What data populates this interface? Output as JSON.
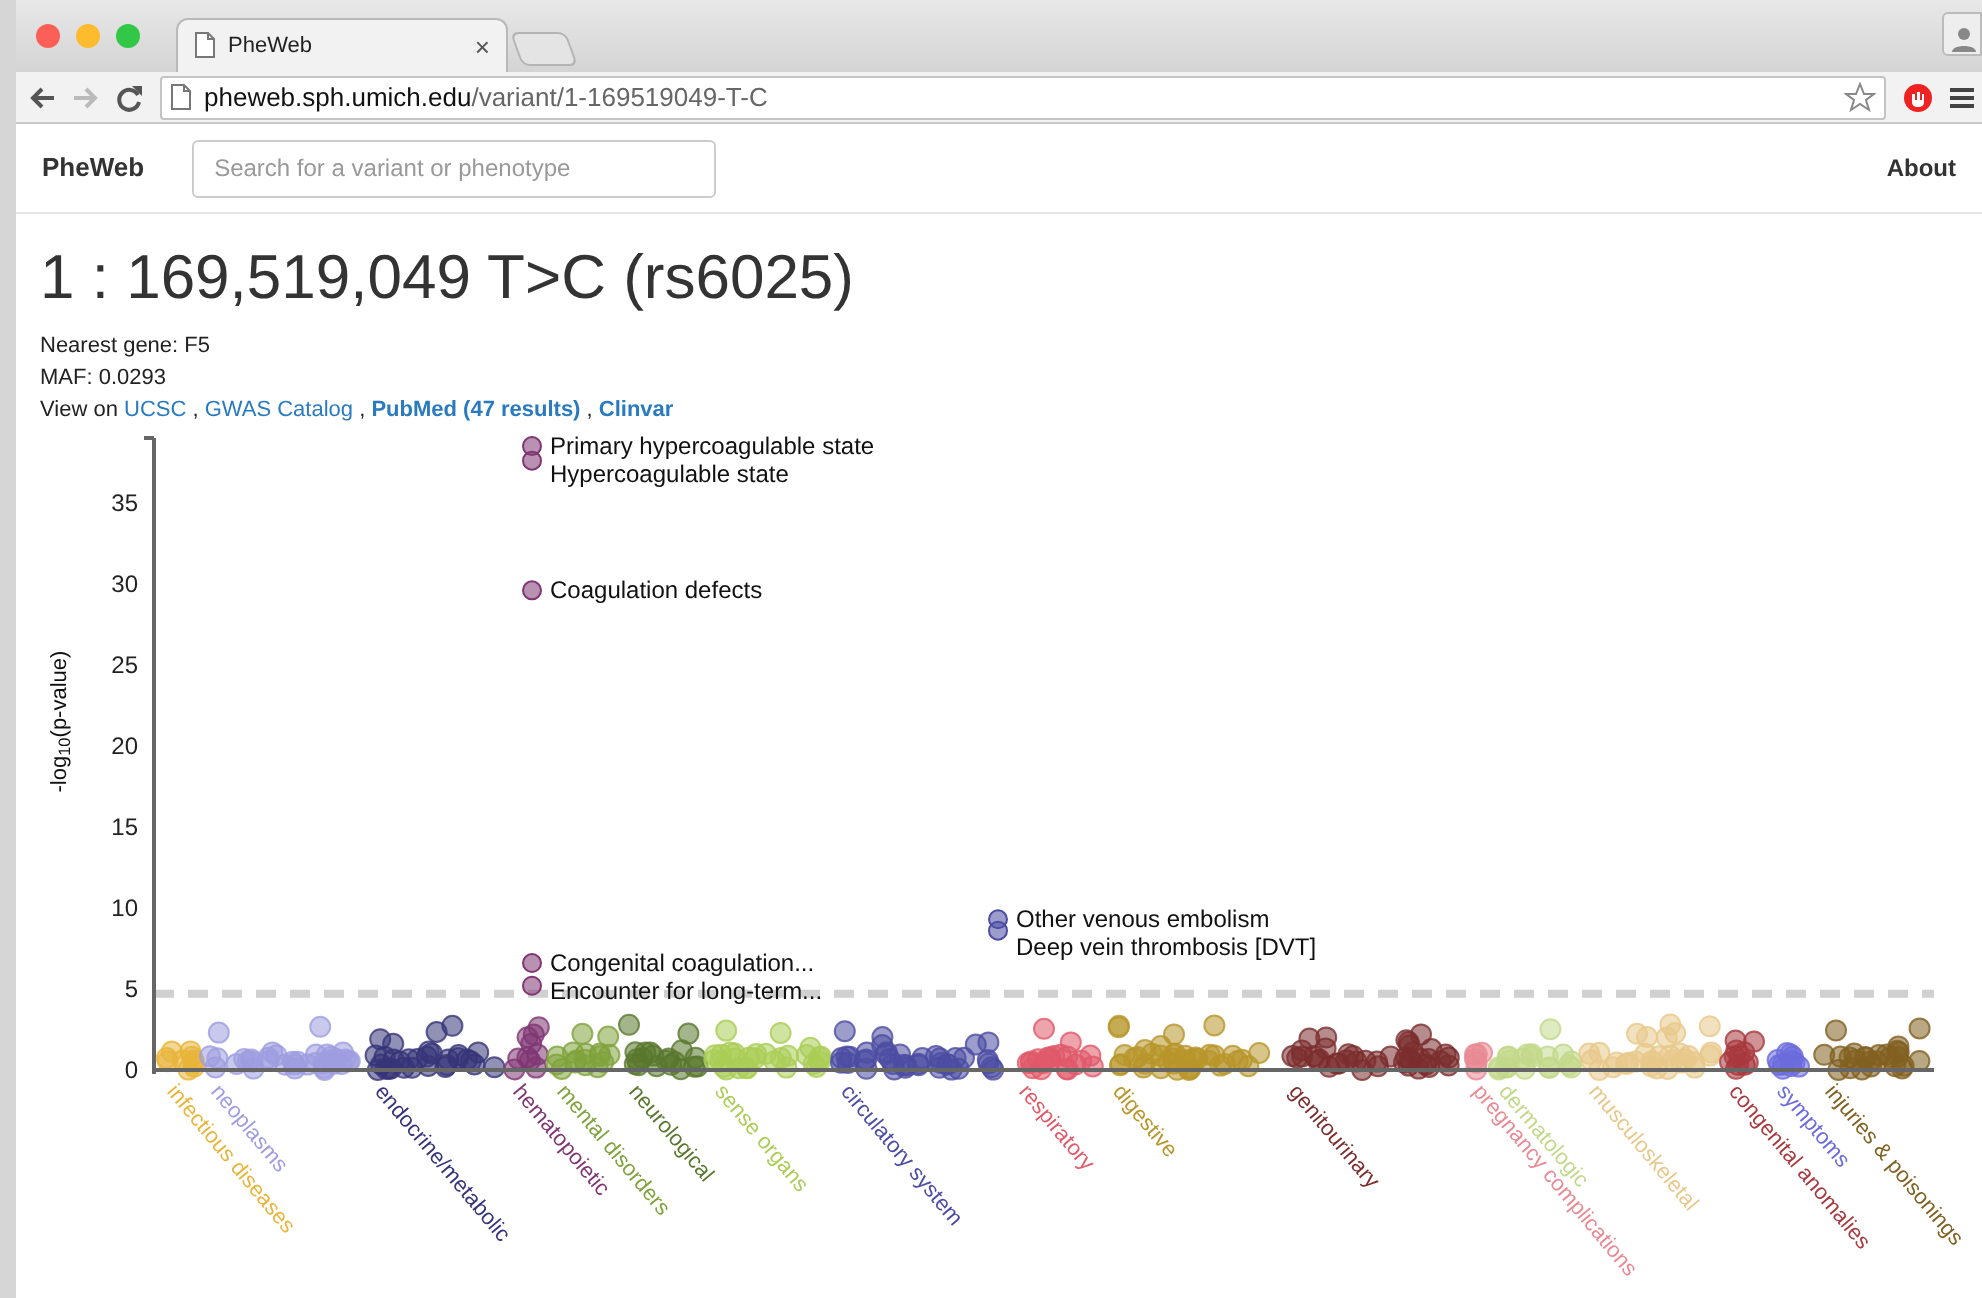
{
  "browser": {
    "tab": {
      "title": "PheWeb",
      "close": "×"
    },
    "address": {
      "host": "pheweb.sph.umich.edu",
      "path": "/variant/1-169519049-T-C"
    }
  },
  "navbar": {
    "brand": "PheWeb",
    "search": {
      "placeholder": "Search for a variant or phenotype"
    },
    "links": [
      "About"
    ]
  },
  "variant": {
    "title": "1 : 169,519,049 T>C (rs6025)",
    "details": [
      "Nearest gene: F5",
      "MAF: 0.0293"
    ],
    "view_on": [
      {
        "kind": "text",
        "text": "View on "
      },
      {
        "kind": "link",
        "text": "UCSC",
        "bold": false
      },
      {
        "kind": "text",
        "text": " , "
      },
      {
        "kind": "link",
        "text": "GWAS Catalog",
        "bold": false
      },
      {
        "kind": "text",
        "text": " , "
      },
      {
        "kind": "link",
        "text": "PubMed (47 results)",
        "bold": true
      },
      {
        "kind": "text",
        "text": " , "
      },
      {
        "kind": "link",
        "text": "Clinvar",
        "bold": true
      }
    ]
  },
  "phewas_plot": {
    "y_axis_title": "-log$_{10}$(p-value)",
    "y_ticks": [
      "35",
      "30",
      "25",
      "20",
      "15",
      "10",
      "5",
      "0"
    ],
    "labeled_points": [
      {
        "text": "Primary hypercoagulable state",
        "color": "#7f3673"
      },
      {
        "text": "Hypercoagulable state",
        "color": "#7f3673"
      },
      {
        "text": "Coagulation defects",
        "color": "#7f3673"
      },
      {
        "text": "Congenital coagulation...",
        "color": "#7f3673"
      },
      {
        "text": "Encounter for long-term...",
        "color": "#7f3673"
      },
      {
        "text": "Other venous embolism",
        "color": "#4c4ca3"
      },
      {
        "text": "Deep vein thrombosis [DVT]",
        "color": "#4c4ca3"
      }
    ],
    "categories": [
      {
        "name": "infectious diseases",
        "color": "#e8b53a"
      },
      {
        "name": "neoplasms",
        "color": "#9d9de0"
      },
      {
        "name": "endocrine/metabolic",
        "color": "#363478"
      },
      {
        "name": "hematopoietic",
        "color": "#7f3673"
      },
      {
        "name": "mental disorders",
        "color": "#7fa33c"
      },
      {
        "name": "neurological",
        "color": "#59782d"
      },
      {
        "name": "sense organs",
        "color": "#aacd55"
      },
      {
        "name": "circulatory system",
        "color": "#4c4ca3"
      },
      {
        "name": "respiratory",
        "color": "#e05a6a"
      },
      {
        "name": "digestive",
        "color": "#b8962a"
      },
      {
        "name": "genitourinary",
        "color": "#7c2e2e"
      },
      {
        "name": "pregnancy complications",
        "color": "#e88a94"
      },
      {
        "name": "dermatologic",
        "color": "#c2d88a"
      },
      {
        "name": "musculoskeletal",
        "color": "#e8c88a"
      },
      {
        "name": "congenital anomalies",
        "color": "#a8393e"
      },
      {
        "name": "symptoms",
        "color": "#6b6bdc"
      },
      {
        "name": "injuries & poisonings",
        "color": "#826021"
      }
    ]
  }
}
